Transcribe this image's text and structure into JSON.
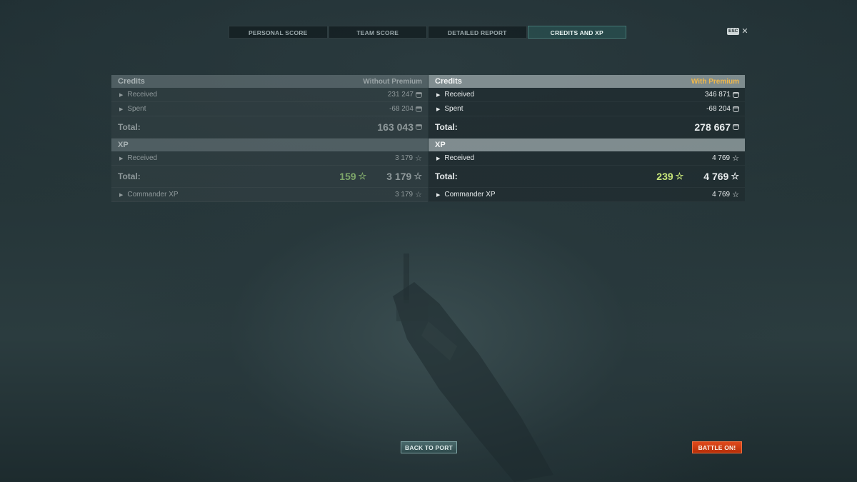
{
  "tabs": [
    "PERSONAL SCORE",
    "TEAM SCORE",
    "DETAILED REPORT",
    "CREDITS AND XP"
  ],
  "active_tab": "CREDITS AND XP",
  "esc": {
    "key": "ESC",
    "close": "✕"
  },
  "without_premium": {
    "credits_title": "Credits",
    "mode_label": "Without Premium",
    "received_label": "Received",
    "received_value": "231 247",
    "spent_label": "Spent",
    "spent_value": "-68 204",
    "total_label": "Total:",
    "total_value": "163 043",
    "xp_title": "XP",
    "xp_received_label": "Received",
    "xp_received_value": "3 179",
    "xp_total_label": "Total:",
    "xp_premium_bonus": "159",
    "xp_total_value": "3 179",
    "commander_label": "Commander XP",
    "commander_value": "3 179"
  },
  "with_premium": {
    "credits_title": "Credits",
    "mode_label": "With Premium",
    "received_label": "Received",
    "received_value": "346 871",
    "spent_label": "Spent",
    "spent_value": "-68 204",
    "total_label": "Total:",
    "total_value": "278 667",
    "xp_title": "XP",
    "xp_received_label": "Received",
    "xp_received_value": "4 769",
    "xp_total_label": "Total:",
    "xp_premium_bonus": "239",
    "xp_total_value": "4 769",
    "commander_label": "Commander XP",
    "commander_value": "4 769"
  },
  "buttons": {
    "back_to_port": "BACK TO PORT",
    "battle_on": "BATTLE ON!"
  },
  "icons": {
    "credits": "credits-icon",
    "xp": "star-icon",
    "expand": "triangle-right-icon"
  },
  "colors": {
    "premium_accent": "#f0b84a",
    "battle_button": "#c8380f",
    "bonus_xp": "#c8e67a",
    "active_tab": "#2d5a58"
  }
}
